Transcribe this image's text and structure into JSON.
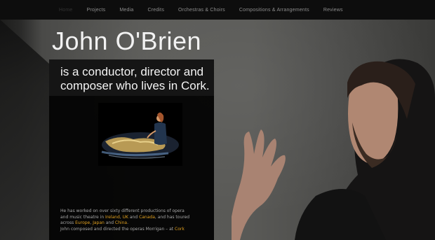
{
  "nav": {
    "items": [
      {
        "label": "Home",
        "active": true
      },
      {
        "label": "Projects"
      },
      {
        "label": "Media"
      },
      {
        "label": "Credits"
      },
      {
        "label": "Orchestras & Choirs"
      },
      {
        "label": "Compositions & Arrangements"
      },
      {
        "label": "Reviews"
      }
    ]
  },
  "header": {
    "title": "John O'Brien"
  },
  "intro": {
    "tagline": "is a conductor, director and composer who lives in Cork.",
    "bio_line1": "He has worked on over sixty different productions of opera",
    "bio_line2_pre": "and music theatre in ",
    "bio_ireland": "Ireland",
    "bio_comma": ", ",
    "bio_uk": "UK",
    "bio_and": " and ",
    "bio_canada": "Canada",
    "bio_line2_post": ", and has toured",
    "bio_line3_pre": "across ",
    "bio_europe": "Europe",
    "bio_comma2": ", ",
    "bio_japan": "Japan",
    "bio_and2": " and ",
    "bio_china": "China",
    "bio_dot": ".",
    "bio_line4_pre": "John composed and directed the operas Morrigan – at ",
    "bio_cork": "Cork"
  },
  "colors": {
    "accent": "#e0a020",
    "nav_bg": "#0d0d0d",
    "panel_bg": "#000000"
  }
}
